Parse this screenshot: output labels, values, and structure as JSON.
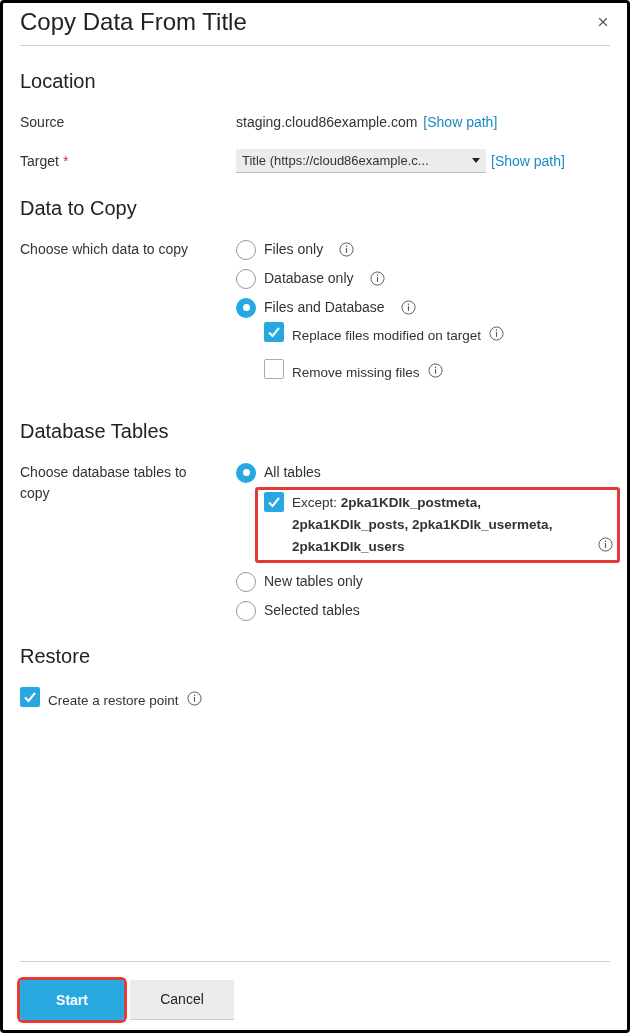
{
  "dialog": {
    "title": "Copy Data From Title"
  },
  "location": {
    "heading": "Location",
    "source": {
      "label": "Source",
      "value": "staging.cloud86example.com",
      "link": "[Show path]"
    },
    "target": {
      "label": "Target",
      "required_mark": "*",
      "value": "Title (https://cloud86example.c...",
      "link": "[Show path]"
    }
  },
  "data_to_copy": {
    "heading": "Data to Copy",
    "label": "Choose which data to copy",
    "options": [
      {
        "label": "Files only",
        "selected": false,
        "info": true
      },
      {
        "label": "Database only",
        "selected": false,
        "info": true
      },
      {
        "label": "Files and Database",
        "selected": true,
        "info": true,
        "children": [
          {
            "label": "Replace files modified on target",
            "checked": true,
            "info": true,
            "highlighted": false
          },
          {
            "label": "Remove missing files",
            "checked": false,
            "info": true,
            "highlighted": false
          }
        ]
      }
    ]
  },
  "database_tables": {
    "heading": "Database Tables",
    "label": "Choose database tables to copy",
    "options": [
      {
        "label": "All tables",
        "selected": true,
        "info": false,
        "children": [
          {
            "label": "Except: **2pka1KDIk_postmeta, 2pka1KDIk_posts, 2pka1KDIk_usermeta, 2pka1KDIk_users**",
            "checked": true,
            "info": true,
            "highlighted": true
          }
        ]
      },
      {
        "label": "New tables only",
        "selected": false,
        "info": false
      },
      {
        "label": "Selected tables",
        "selected": false,
        "info": false
      }
    ]
  },
  "restore": {
    "heading": "Restore",
    "checkboxes": [
      {
        "label": "Create a restore point",
        "checked": true,
        "info": true
      }
    ]
  },
  "buttons": [
    {
      "label": "Start",
      "kind": "primary",
      "highlighted": true
    },
    {
      "label": "Cancel",
      "kind": "secondary",
      "highlighted": false
    }
  ]
}
